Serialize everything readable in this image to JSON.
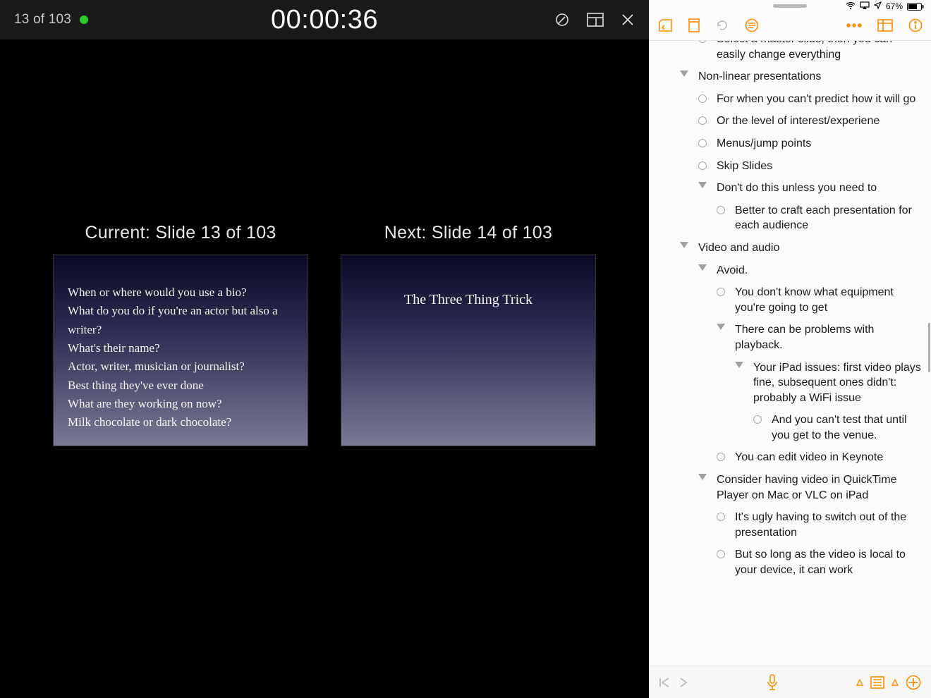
{
  "presenter": {
    "counter": "13 of 103",
    "timer": "00:00:36",
    "current_label": "Current: Slide 13 of 103",
    "next_label": "Next: Slide 14 of 103",
    "current_slide": {
      "lines": [
        "When or where would you use a bio?",
        "What do you do if you're an actor but also a writer?",
        "What's their name?",
        "Actor, writer, musician or journalist?",
        "Best thing they've ever done",
        "What are they working on now?",
        "Milk chocolate or dark chocolate?"
      ]
    },
    "next_slide": {
      "title": "The Three Thing Trick"
    }
  },
  "status": {
    "battery_pct": "67%"
  },
  "outline": [
    {
      "indent": 64,
      "type": "bullet",
      "text": "Select a master slide, then you can easily change everything"
    },
    {
      "indent": 38,
      "type": "tri",
      "text": "Non-linear presentations"
    },
    {
      "indent": 64,
      "type": "bullet",
      "text": "For when you can't predict how it will go"
    },
    {
      "indent": 64,
      "type": "bullet",
      "text": "Or the level of interest/experiene"
    },
    {
      "indent": 64,
      "type": "bullet",
      "text": "Menus/jump points"
    },
    {
      "indent": 64,
      "type": "bullet",
      "text": "Skip Slides"
    },
    {
      "indent": 64,
      "type": "tri",
      "text": "Don't do this unless you need to"
    },
    {
      "indent": 90,
      "type": "bullet",
      "text": "Better to craft each presentation for each audience"
    },
    {
      "indent": 38,
      "type": "tri",
      "text": "Video and audio"
    },
    {
      "indent": 64,
      "type": "tri",
      "text": "Avoid."
    },
    {
      "indent": 90,
      "type": "bullet",
      "text": "You don't know what equipment you're going to get"
    },
    {
      "indent": 90,
      "type": "tri",
      "text": "There can be problems with playback."
    },
    {
      "indent": 116,
      "type": "tri",
      "text": "Your iPad issues: first video plays fine, subsequent ones didn't: probably a WiFi issue"
    },
    {
      "indent": 142,
      "type": "bullet",
      "text": "And you can't test that until you get to the venue."
    },
    {
      "indent": 90,
      "type": "bullet",
      "text": "You can edit video in Keynote"
    },
    {
      "indent": 64,
      "type": "tri",
      "text": "Consider having video in QuickTime Player on Mac or VLC on iPad"
    },
    {
      "indent": 90,
      "type": "bullet",
      "text": "It's ugly having to switch out of the presentation"
    },
    {
      "indent": 90,
      "type": "bullet",
      "text": "But so long as the video is local to your device, it can work"
    }
  ]
}
